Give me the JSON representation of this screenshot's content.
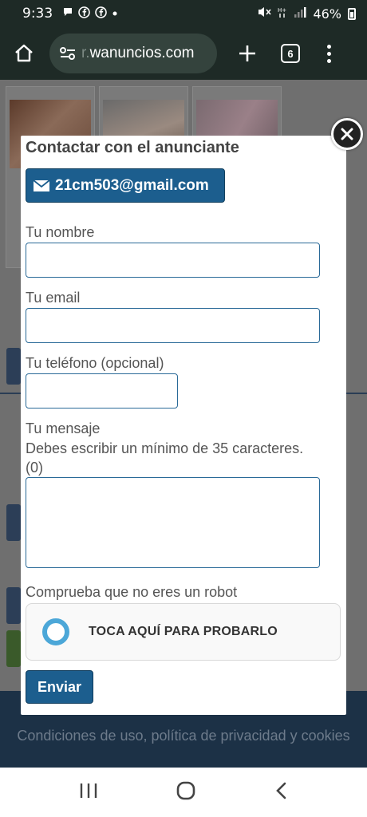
{
  "status_bar": {
    "time": "9:33",
    "battery": "46%"
  },
  "browser": {
    "url_prefix": "r.",
    "url_domain": "wanuncios.com",
    "tab_count": "6"
  },
  "background_page": {
    "footer_text": "Condiciones de uso, política de privacidad y cookies"
  },
  "modal": {
    "title": "Contactar con el anunciante",
    "email_button": "21cm503@gmail.com",
    "name_label": "Tu nombre",
    "name_value": "",
    "email_label": "Tu email",
    "email_value": "",
    "phone_label": "Tu teléfono (opcional)",
    "phone_value": "",
    "message_label": "Tu mensaje",
    "message_hint": "Debes escribir un mínimo de 35 caracteres.",
    "message_count": "(0)",
    "message_value": "",
    "robot_label": "Comprueba que no eres un robot",
    "captcha_label": "TOCA AQUÍ PARA PROBARLO",
    "send_button": "Enviar"
  },
  "colors": {
    "primary_button": "#1c5e8e",
    "captcha_ring": "#4ca7d8",
    "overlay": "#6f6f6f",
    "browser_bar": "#1e2a26"
  }
}
